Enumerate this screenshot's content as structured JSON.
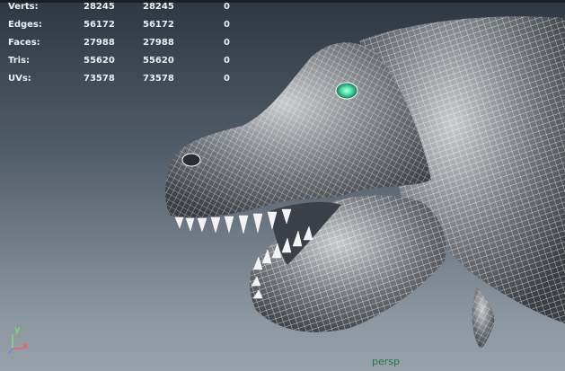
{
  "hud": {
    "rows": [
      {
        "label": "Verts:",
        "v1": "28245",
        "v2": "28245",
        "v3": "0"
      },
      {
        "label": "Edges:",
        "v1": "56172",
        "v2": "56172",
        "v3": "0"
      },
      {
        "label": "Faces:",
        "v1": "27988",
        "v2": "27988",
        "v3": "0"
      },
      {
        "label": "Tris:",
        "v1": "55620",
        "v2": "55620",
        "v3": "0"
      },
      {
        "label": "UVs:",
        "v1": "73578",
        "v2": "73578",
        "v3": "0"
      }
    ]
  },
  "axis": {
    "y": "y",
    "x": "x"
  },
  "camera": {
    "name": "persp"
  },
  "colors": {
    "wire": "#ffffff",
    "eye": "#46e0a8",
    "bg_top": "#2e3742",
    "bg_bottom": "#98a1a9"
  }
}
